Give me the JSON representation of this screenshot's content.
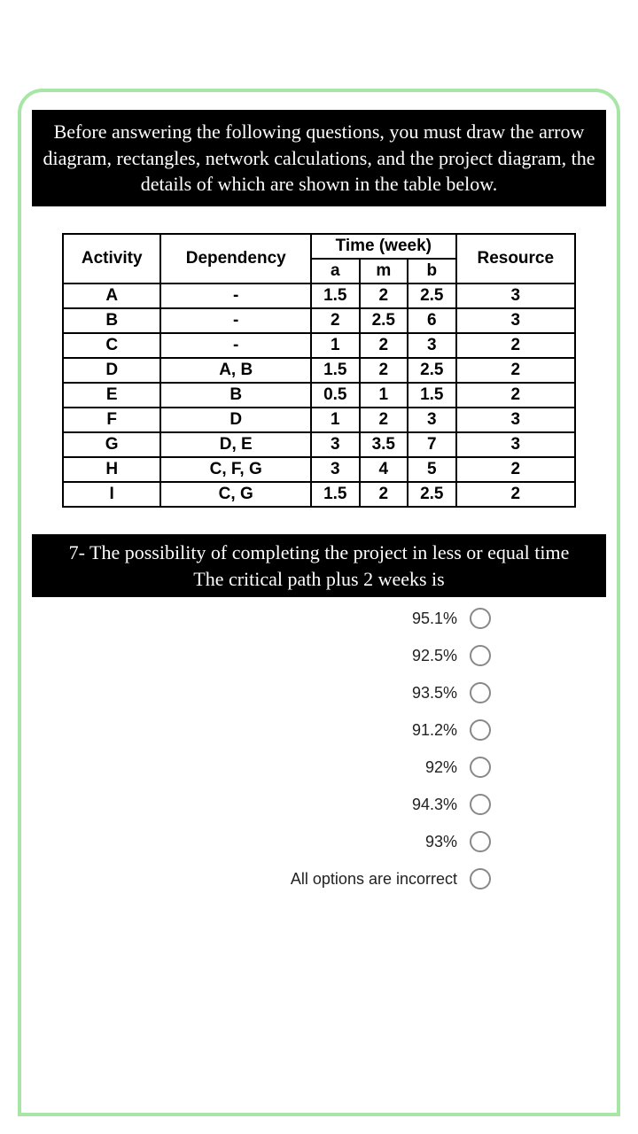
{
  "instruction_text": "Before answering the following questions, you must draw the arrow diagram, rectangles, network calculations, and the project diagram, the details of which are shown in the table below.",
  "table": {
    "headers": {
      "activity": "Activity",
      "dependency": "Dependency",
      "time_group": "Time (week)",
      "a": "a",
      "m": "m",
      "b": "b",
      "resource": "Resource"
    },
    "rows": [
      {
        "activity": "A",
        "dependency": "-",
        "a": "1.5",
        "m": "2",
        "b": "2.5",
        "resource": "3"
      },
      {
        "activity": "B",
        "dependency": "-",
        "a": "2",
        "m": "2.5",
        "b": "6",
        "resource": "3"
      },
      {
        "activity": "C",
        "dependency": "-",
        "a": "1",
        "m": "2",
        "b": "3",
        "resource": "2"
      },
      {
        "activity": "D",
        "dependency": "A, B",
        "a": "1.5",
        "m": "2",
        "b": "2.5",
        "resource": "2"
      },
      {
        "activity": "E",
        "dependency": "B",
        "a": "0.5",
        "m": "1",
        "b": "1.5",
        "resource": "2"
      },
      {
        "activity": "F",
        "dependency": "D",
        "a": "1",
        "m": "2",
        "b": "3",
        "resource": "3"
      },
      {
        "activity": "G",
        "dependency": "D, E",
        "a": "3",
        "m": "3.5",
        "b": "7",
        "resource": "3"
      },
      {
        "activity": "H",
        "dependency": "C, F, G",
        "a": "3",
        "m": "4",
        "b": "5",
        "resource": "2"
      },
      {
        "activity": "I",
        "dependency": "C, G",
        "a": "1.5",
        "m": "2",
        "b": "2.5",
        "resource": "2"
      }
    ]
  },
  "question": {
    "line1": "7- The possibility of completing the project in less or equal time",
    "line2": "The critical path plus 2 weeks is"
  },
  "options": [
    "95.1%",
    "92.5%",
    "93.5%",
    "91.2%",
    "92%",
    "94.3%",
    "93%",
    "All options are incorrect"
  ]
}
